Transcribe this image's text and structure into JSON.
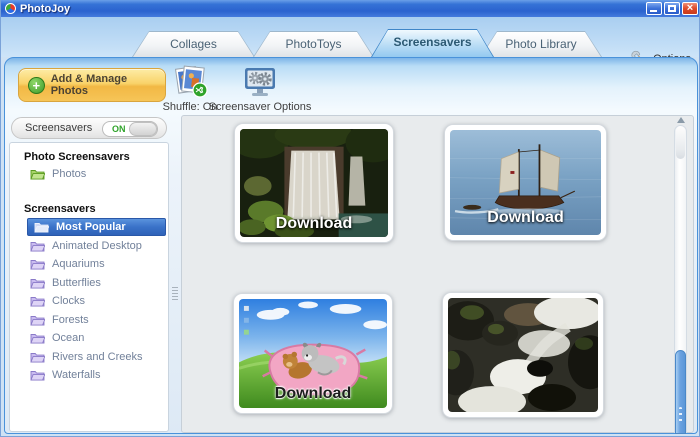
{
  "window": {
    "title": "PhotoJoy"
  },
  "tabs": [
    {
      "label": "Collages",
      "active": false
    },
    {
      "label": "PhotoToys",
      "active": false
    },
    {
      "label": "Screensavers",
      "active": true
    },
    {
      "label": "Photo Library",
      "active": false
    }
  ],
  "options": {
    "label": "Options",
    "icon": "wrench-icon"
  },
  "toolbar": {
    "add_manage_photos": "Add & Manage Photos",
    "shuffle": "Shuffle: On",
    "screensaver_options": "Screensaver Options"
  },
  "sidebar": {
    "toggle": {
      "label": "Screensavers",
      "state": "ON"
    },
    "photo_section": {
      "heading": "Photo Screensavers",
      "items": [
        {
          "label": "Photos",
          "folder_color": "green"
        }
      ]
    },
    "screensaver_section": {
      "heading": "Screensavers",
      "items": [
        {
          "label": "Most Popular",
          "selected": true
        },
        {
          "label": "Animated Desktop",
          "selected": false
        },
        {
          "label": "Aquariums",
          "selected": false
        },
        {
          "label": "Butterflies",
          "selected": false
        },
        {
          "label": "Clocks",
          "selected": false
        },
        {
          "label": "Forests",
          "selected": false
        },
        {
          "label": "Ocean",
          "selected": false
        },
        {
          "label": "Rivers and Creeks",
          "selected": false
        },
        {
          "label": "Waterfalls",
          "selected": false
        }
      ]
    }
  },
  "gallery": {
    "cards": [
      {
        "subject": "waterfall-screensaver",
        "caption": "Download"
      },
      {
        "subject": "sailing-ship-screensaver",
        "caption": "Download"
      },
      {
        "subject": "cartoon-pets-pillow-screensaver",
        "caption": "Download"
      },
      {
        "subject": "rocky-creek-screensaver",
        "caption": ""
      }
    ]
  },
  "icons": {
    "app_logo": "pinwheel",
    "minimize": "dash",
    "maximize": "square",
    "close": "x",
    "add": "plus-circle",
    "shuffle": "photo-stack-shuffle",
    "screensaver_options": "monitor-gears",
    "options": "wrench",
    "folder": "open-folder",
    "scroll_up": "triangle-up"
  },
  "colors": {
    "titlebar_blue": "#2b63cf",
    "accent_orange": "#f2b844",
    "selected_blue": "#3a72c8",
    "toggle_on_green": "#2fa32a",
    "panel_border_blue": "#4a92da"
  }
}
